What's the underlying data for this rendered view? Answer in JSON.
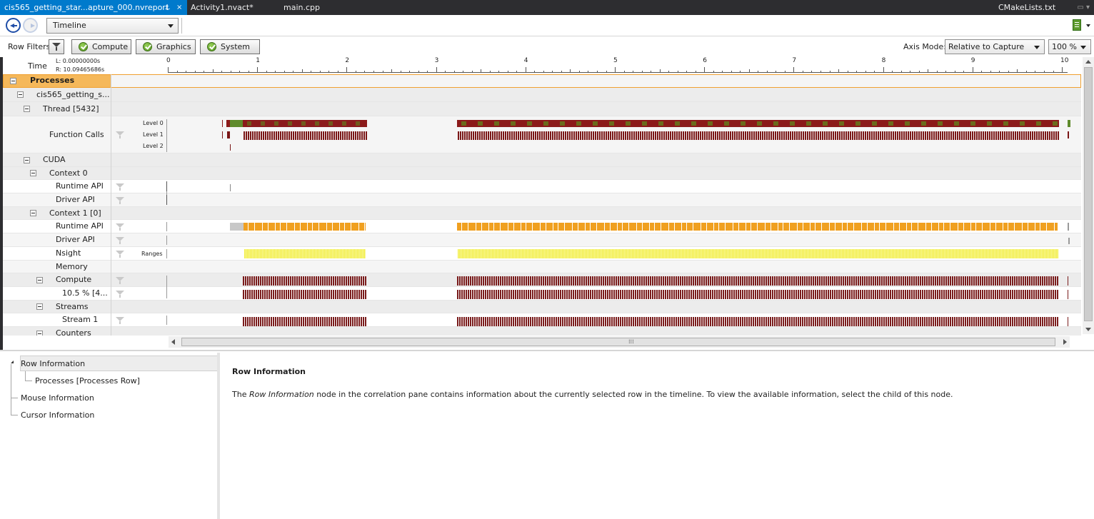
{
  "tabs": [
    {
      "label": "cis565_getting_star...apture_000.nvreport",
      "active": true,
      "pin": "⊥",
      "close": "×"
    },
    {
      "label": "Activity1.nvact*",
      "active": false
    },
    {
      "label": "main.cpp",
      "active": false
    },
    {
      "label": "CMakeLists.txt",
      "active": false
    }
  ],
  "toolbar": {
    "view_select": "Timeline"
  },
  "filters": {
    "label": "Row Filters",
    "buttons": [
      "Compute",
      "Graphics",
      "System"
    ],
    "axis_mode_label": "Axis Mode:",
    "axis_mode_value": "Relative to Capture",
    "zoom_value": "100 %"
  },
  "ruler": {
    "label": "Time",
    "left": "L: 0.00000000s",
    "right": "R: 10.09465686s",
    "ticks": [
      "0",
      "1",
      "2",
      "3",
      "4",
      "5",
      "6",
      "7",
      "8",
      "9",
      "10"
    ]
  },
  "rows": {
    "processes": "Processes",
    "process_name": "cis565_getting_s...",
    "thread": "Thread [5432]",
    "function_calls": "Function Calls",
    "levels": [
      "Level 0",
      "Level 1",
      "Level 2"
    ],
    "cuda": "CUDA",
    "context0": "Context 0",
    "ctx0_runtime": "Runtime API",
    "ctx0_driver": "Driver API",
    "context1": "Context 1 [0]",
    "ctx1_runtime": "Runtime API",
    "ctx1_driver": "Driver API",
    "nsight": "Nsight",
    "ranges": "Ranges",
    "memory": "Memory",
    "compute": "Compute",
    "compute_pct": "10.5 % [4...",
    "streams": "Streams",
    "stream1": "Stream 1",
    "counters": "Counters"
  },
  "colors": {
    "tab_active": "#007acc",
    "level0": "#8b1a1a",
    "level1": "#7a1616",
    "green": "#5f8b2c",
    "runtime_orange": "#f0a020",
    "nsight_yellow": "#f2ee3c",
    "compute_maroon": "#7a1c1c"
  },
  "tree": {
    "row_information": "Row Information",
    "processes_row": "Processes [Processes Row]",
    "mouse_information": "Mouse Information",
    "cursor_information": "Cursor Information"
  },
  "info": {
    "title": "Row Information",
    "text_pre": "The ",
    "text_em": "Row Information",
    "text_post": " node in the correlation pane contains information about the currently selected row in the timeline. To view the available information, select the child of this node."
  }
}
